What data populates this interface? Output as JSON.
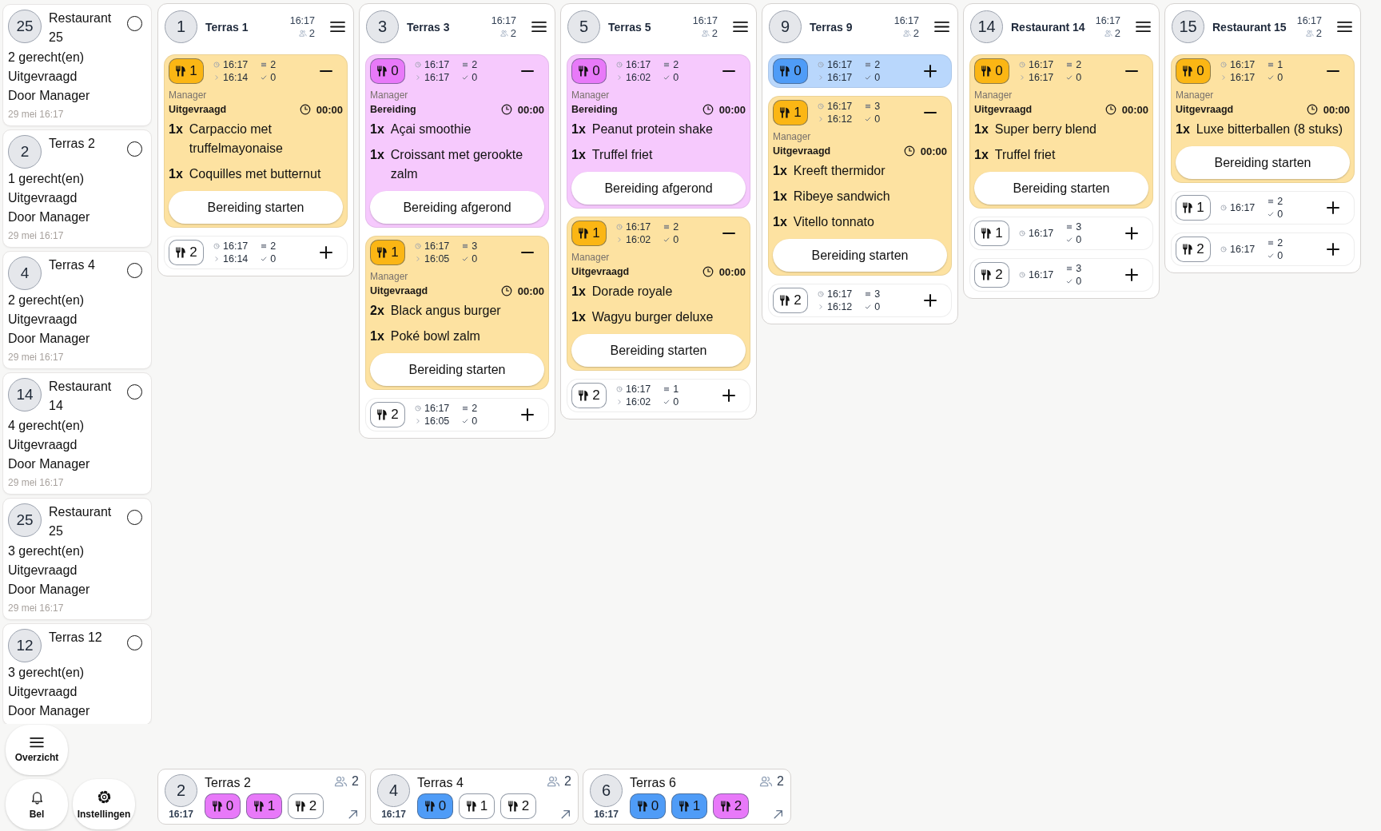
{
  "sidebar": {
    "items": [
      {
        "number": "25",
        "name": "Restaurant 25",
        "dishes": "2 gerecht(en)",
        "status": "Uitgevraagd",
        "by": "Door Manager",
        "date": "29 mei 16:17",
        "selected": false
      },
      {
        "number": "2",
        "name": "Terras 2",
        "dishes": "1 gerecht(en)",
        "status": "Uitgevraagd",
        "by": "Door Manager",
        "date": "29 mei 16:17",
        "selected": false
      },
      {
        "number": "4",
        "name": "Terras 4",
        "dishes": "2 gerecht(en)",
        "status": "Uitgevraagd",
        "by": "Door Manager",
        "date": "29 mei 16:17",
        "selected": false
      },
      {
        "number": "14",
        "name": "Restaurant 14",
        "dishes": "4 gerecht(en)",
        "status": "Uitgevraagd",
        "by": "Door Manager",
        "date": "29 mei 16:17",
        "selected": false
      },
      {
        "number": "25",
        "name": "Restaurant 25",
        "dishes": "3 gerecht(en)",
        "status": "Uitgevraagd",
        "by": "Door Manager",
        "date": "29 mei 16:17",
        "selected": false
      },
      {
        "number": "12",
        "name": "Terras 12",
        "dishes": "3 gerecht(en)",
        "status": "Uitgevraagd",
        "by": "Door Manager",
        "selected": false
      }
    ],
    "buttons": [
      {
        "kind": "menu",
        "label": "Overzicht"
      },
      {
        "kind": "bell",
        "label": "Bel"
      },
      {
        "kind": "gear",
        "label": "Instellingen"
      }
    ]
  },
  "tables": [
    {
      "number": "1",
      "name": "Terras 1",
      "time": "16:17",
      "guests": "2",
      "courses": [
        {
          "course": "1",
          "color": "#fbb614",
          "expanded": true,
          "time": "16:17",
          "since": "16:14",
          "lines": "2",
          "done": "0",
          "by": "Manager",
          "status": "Uitgevraagd",
          "timer": "00:00",
          "items": [
            {
              "qty": "1x",
              "name": "Carpaccio met truffelmayonaise"
            },
            {
              "qty": "1x",
              "name": "Coquilles met butternut"
            }
          ],
          "action": "Bereiding starten"
        },
        {
          "course": "2",
          "color": "#ffffff",
          "expanded": false,
          "time": "16:17",
          "since": "16:14",
          "lines": "2",
          "done": "0"
        }
      ]
    },
    {
      "number": "3",
      "name": "Terras 3",
      "time": "16:17",
      "guests": "2",
      "courses": [
        {
          "course": "0",
          "color": "#e879f9",
          "expanded": true,
          "time": "16:17",
          "since": "16:17",
          "lines": "2",
          "done": "0",
          "by": "Manager",
          "status": "Bereiding",
          "timer": "00:00",
          "items": [
            {
              "qty": "1x",
              "name": "Açai smoothie"
            },
            {
              "qty": "1x",
              "name": "Croissant met gerookte zalm"
            }
          ],
          "action": "Bereiding afgerond"
        },
        {
          "course": "1",
          "color": "#fbb614",
          "expanded": true,
          "time": "16:17",
          "since": "16:05",
          "lines": "3",
          "done": "0",
          "by": "Manager",
          "status": "Uitgevraagd",
          "timer": "00:00",
          "items": [
            {
              "qty": "2x",
              "name": "Black angus burger"
            },
            {
              "qty": "1x",
              "name": "Poké bowl zalm"
            }
          ],
          "action": "Bereiding starten"
        },
        {
          "course": "2",
          "color": "#ffffff",
          "expanded": false,
          "time": "16:17",
          "since": "16:05",
          "lines": "2",
          "done": "0"
        }
      ]
    },
    {
      "number": "5",
      "name": "Terras 5",
      "time": "16:17",
      "guests": "2",
      "courses": [
        {
          "course": "0",
          "color": "#e879f9",
          "expanded": true,
          "time": "16:17",
          "since": "16:02",
          "lines": "2",
          "done": "0",
          "by": "Manager",
          "status": "Bereiding",
          "timer": "00:00",
          "items": [
            {
              "qty": "1x",
              "name": "Peanut protein shake"
            },
            {
              "qty": "1x",
              "name": "Truffel friet"
            }
          ],
          "action": "Bereiding afgerond"
        },
        {
          "course": "1",
          "color": "#fbb614",
          "expanded": true,
          "time": "16:17",
          "since": "16:02",
          "lines": "2",
          "done": "0",
          "by": "Manager",
          "status": "Uitgevraagd",
          "timer": "00:00",
          "items": [
            {
              "qty": "1x",
              "name": "Dorade royale"
            },
            {
              "qty": "1x",
              "name": "Wagyu burger deluxe"
            }
          ],
          "action": "Bereiding starten"
        },
        {
          "course": "2",
          "color": "#ffffff",
          "expanded": false,
          "time": "16:17",
          "since": "16:02",
          "lines": "1",
          "done": "0"
        }
      ]
    },
    {
      "number": "9",
      "name": "Terras 9",
      "time": "16:17",
      "guests": "2",
      "courses": [
        {
          "course": "0",
          "color": "#4f9cf7",
          "expanded": false,
          "time": "16:17",
          "since": "16:17",
          "lines": "2",
          "done": "0"
        },
        {
          "course": "1",
          "color": "#fbb614",
          "expanded": true,
          "time": "16:17",
          "since": "16:12",
          "lines": "3",
          "done": "0",
          "by": "Manager",
          "status": "Uitgevraagd",
          "timer": "00:00",
          "items": [
            {
              "qty": "1x",
              "name": "Kreeft thermidor"
            },
            {
              "qty": "1x",
              "name": "Ribeye sandwich"
            },
            {
              "qty": "1x",
              "name": "Vitello tonnato"
            }
          ],
          "action": "Bereiding starten"
        },
        {
          "course": "2",
          "color": "#ffffff",
          "expanded": false,
          "time": "16:17",
          "since": "16:12",
          "lines": "3",
          "done": "0"
        }
      ]
    },
    {
      "number": "14",
      "name": "Restaurant 14",
      "time": "16:17",
      "guests": "2",
      "courses": [
        {
          "course": "0",
          "color": "#fbb614",
          "expanded": true,
          "time": "16:17",
          "since": "16:17",
          "lines": "2",
          "done": "0",
          "by": "Manager",
          "status": "Uitgevraagd",
          "timer": "00:00",
          "items": [
            {
              "qty": "1x",
              "name": "Super berry blend"
            },
            {
              "qty": "1x",
              "name": "Truffel friet"
            }
          ],
          "action": "Bereiding starten"
        },
        {
          "course": "1",
          "color": "#ffffff",
          "expanded": false,
          "time": "16:17",
          "lines": "3",
          "done": "0"
        },
        {
          "course": "2",
          "color": "#ffffff",
          "expanded": false,
          "time": "16:17",
          "lines": "3",
          "done": "0"
        }
      ]
    },
    {
      "number": "15",
      "name": "Restaurant 15",
      "time": "16:17",
      "guests": "2",
      "courses": [
        {
          "course": "0",
          "color": "#fbb614",
          "expanded": true,
          "time": "16:17",
          "since": "16:17",
          "lines": "1",
          "done": "0",
          "by": "Manager",
          "status": "Uitgevraagd",
          "timer": "00:00",
          "items": [
            {
              "qty": "1x",
              "name": "Luxe bitterballen (8 stuks)"
            }
          ],
          "action": "Bereiding starten"
        },
        {
          "course": "1",
          "color": "#ffffff",
          "expanded": false,
          "time": "16:17",
          "lines": "2",
          "done": "0"
        },
        {
          "course": "2",
          "color": "#ffffff",
          "expanded": false,
          "time": "16:17",
          "lines": "2",
          "done": "0"
        }
      ]
    }
  ],
  "bottom_tables": [
    {
      "number": "2",
      "name": "Terras 2",
      "time": "16:17",
      "guests": "2",
      "courses": [
        {
          "course": "0",
          "color": "#e879f9"
        },
        {
          "course": "1",
          "color": "#e879f9"
        },
        {
          "course": "2",
          "color": "#ffffff"
        }
      ]
    },
    {
      "number": "4",
      "name": "Terras 4",
      "time": "16:17",
      "guests": "2",
      "courses": [
        {
          "course": "0",
          "color": "#4f9cf7"
        },
        {
          "course": "1",
          "color": "#ffffff"
        },
        {
          "course": "2",
          "color": "#ffffff"
        }
      ]
    },
    {
      "number": "6",
      "name": "Terras 6",
      "time": "16:17",
      "guests": "2",
      "courses": [
        {
          "course": "0",
          "color": "#4f9cf7"
        },
        {
          "course": "1",
          "color": "#4f9cf7"
        },
        {
          "course": "2",
          "color": "#e879f9"
        }
      ]
    }
  ]
}
